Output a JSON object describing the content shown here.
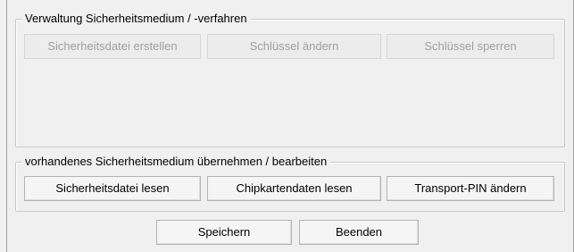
{
  "group_manage": {
    "title": "Verwaltung Sicherheitsmedium / -verfahren",
    "buttons": {
      "create_file": "Sicherheitsdatei erstellen",
      "change_key": "Schlüssel ändern",
      "lock_key": "Schlüssel sperren"
    },
    "buttons_enabled": false
  },
  "group_existing": {
    "title": "vorhandenes Sicherheitsmedium übernehmen / bearbeiten",
    "buttons": {
      "read_file": "Sicherheitsdatei lesen",
      "read_chipcard": "Chipkartendaten lesen",
      "change_transport_pin": "Transport-PIN ändern"
    },
    "buttons_enabled": true
  },
  "footer": {
    "save": "Speichern",
    "exit": "Beenden"
  },
  "colors": {
    "dialog_background": "#f0f0f0",
    "disabled_text": "#a0a0a0",
    "group_border": "#c8c8c8"
  }
}
